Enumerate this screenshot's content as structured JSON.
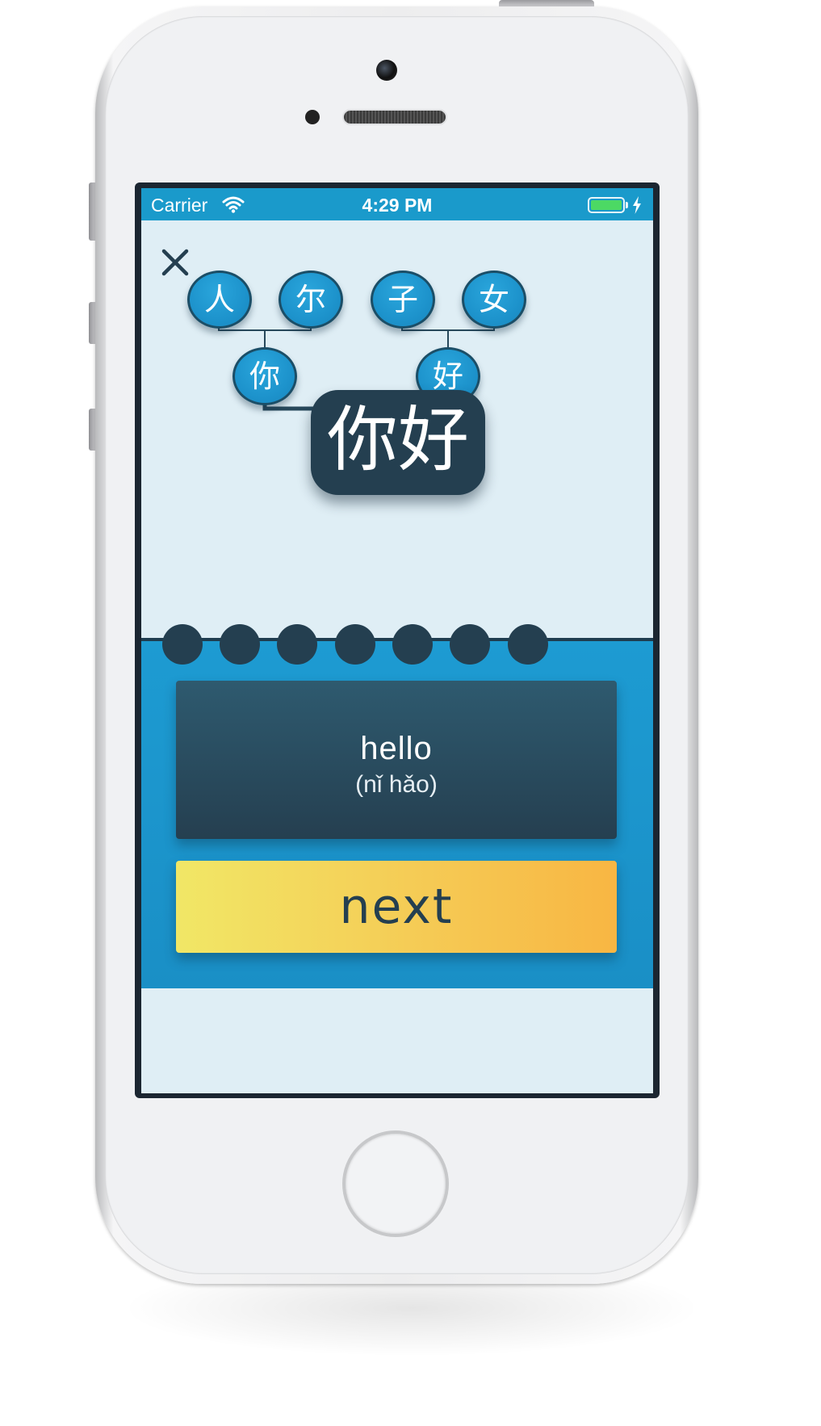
{
  "status_bar": {
    "carrier": "Carrier",
    "time": "4:29 PM"
  },
  "lesson": {
    "components": [
      "人",
      "尔",
      "子",
      "女"
    ],
    "characters": [
      "你",
      "好"
    ],
    "word": "你好",
    "meaning": "hello",
    "pinyin": "(nǐ hǎo)"
  },
  "progress": {
    "total_steps": 7
  },
  "actions": {
    "next_label": "next"
  },
  "colors": {
    "status_bar": "#1a9acb",
    "node_blue": "#1d93cc",
    "dark_navy": "#243f50",
    "upper_background": "#dfeef5",
    "next_gradient_start": "#f1e766",
    "next_gradient_end": "#f8b643"
  },
  "icons": {
    "close": "close-icon",
    "wifi": "wifi-icon",
    "battery": "battery-icon",
    "charging": "charging-icon"
  }
}
